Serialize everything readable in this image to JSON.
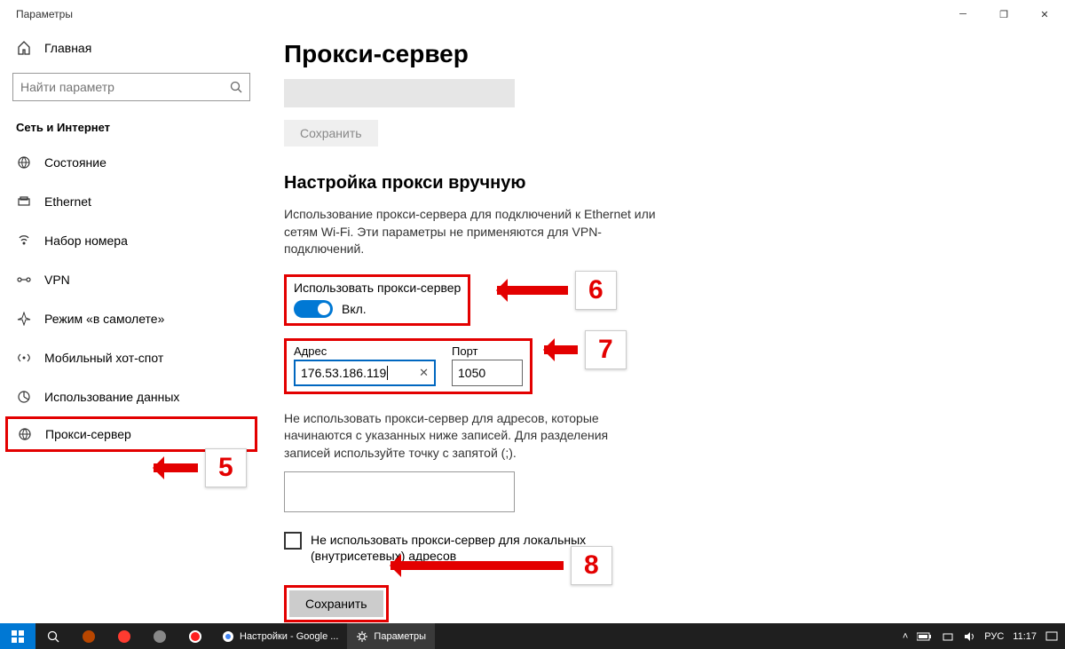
{
  "window": {
    "title": "Параметры"
  },
  "sidebar": {
    "home": "Главная",
    "search_placeholder": "Найти параметр",
    "section": "Сеть и Интернет",
    "items": [
      {
        "label": "Состояние"
      },
      {
        "label": "Ethernet"
      },
      {
        "label": "Набор номера"
      },
      {
        "label": "VPN"
      },
      {
        "label": "Режим «в самолете»"
      },
      {
        "label": "Мобильный хот-спот"
      },
      {
        "label": "Использование данных"
      },
      {
        "label": "Прокси-сервер"
      }
    ]
  },
  "main": {
    "h1": "Прокси-сервер",
    "save_disabled": "Сохранить",
    "h2": "Настройка прокси вручную",
    "desc": "Использование прокси-сервера для подключений к Ethernet или сетям Wi-Fi. Эти параметры не применяются для VPN-подключений.",
    "toggle_label": "Использовать прокси-сервер",
    "toggle_state": "Вкл.",
    "addr_label": "Адрес",
    "addr_value": "176.53.186.119",
    "port_label": "Порт",
    "port_value": "1050",
    "exclusion_text": "Не использовать прокси-сервер для адресов, которые начинаются с указанных ниже записей. Для разделения записей используйте точку с запятой (;).",
    "checkbox_label": "Не использовать прокси-сервер для локальных (внутрисетевых) адресов",
    "save": "Сохранить"
  },
  "annotations": {
    "n5": "5",
    "n6": "6",
    "n7": "7",
    "n8": "8"
  },
  "taskbar": {
    "app1": "Настройки - Google ...",
    "app2": "Параметры",
    "lang": "РУС",
    "time": "11:17"
  }
}
